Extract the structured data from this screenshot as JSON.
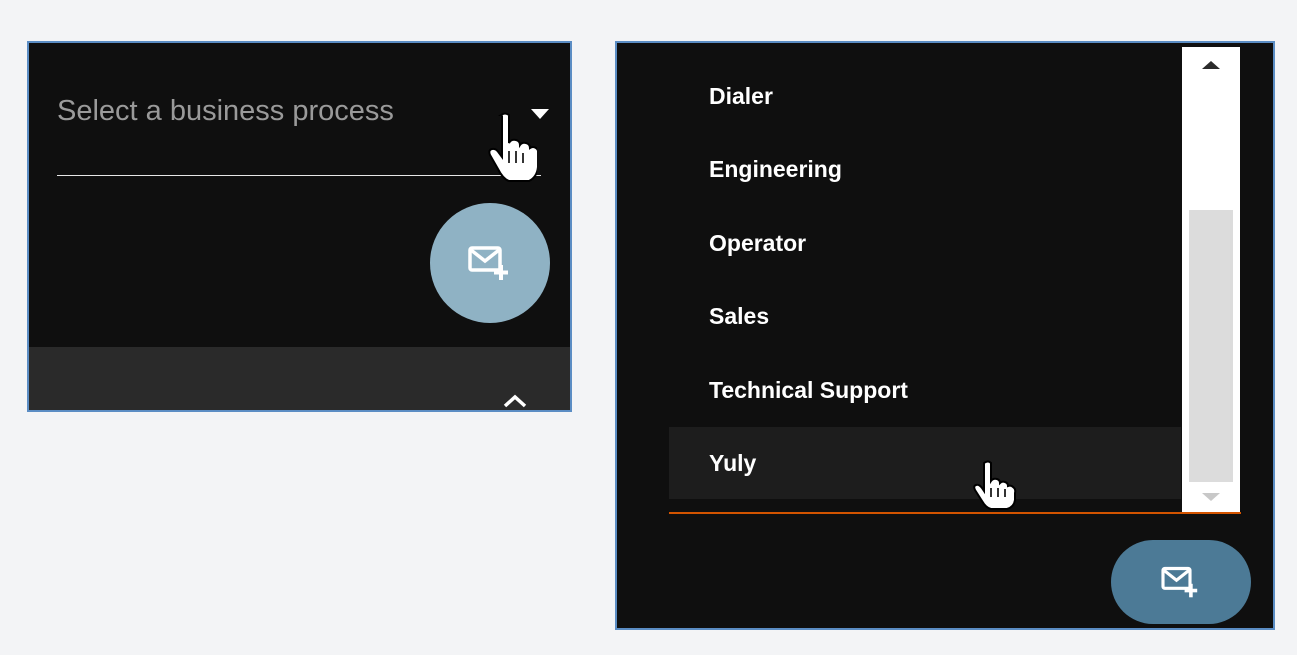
{
  "left_panel": {
    "select": {
      "placeholder": "Select a business process"
    },
    "fab_icon": "mail-add-icon",
    "collapse_icon": "chevron-up-icon"
  },
  "right_panel": {
    "options": [
      {
        "label": "Dialer"
      },
      {
        "label": "Engineering"
      },
      {
        "label": "Operator"
      },
      {
        "label": "Sales"
      },
      {
        "label": "Technical Support"
      },
      {
        "label": "Yuly"
      }
    ],
    "hovered_option": "Yuly",
    "fab_icon": "mail-add-icon"
  },
  "colors": {
    "panel_background": "#0f0f0f",
    "panel_border": "#5b8dc4",
    "fab_light": "#8fb2c4",
    "fab_dark": "#4c7a96",
    "active_underline": "#d35400"
  }
}
